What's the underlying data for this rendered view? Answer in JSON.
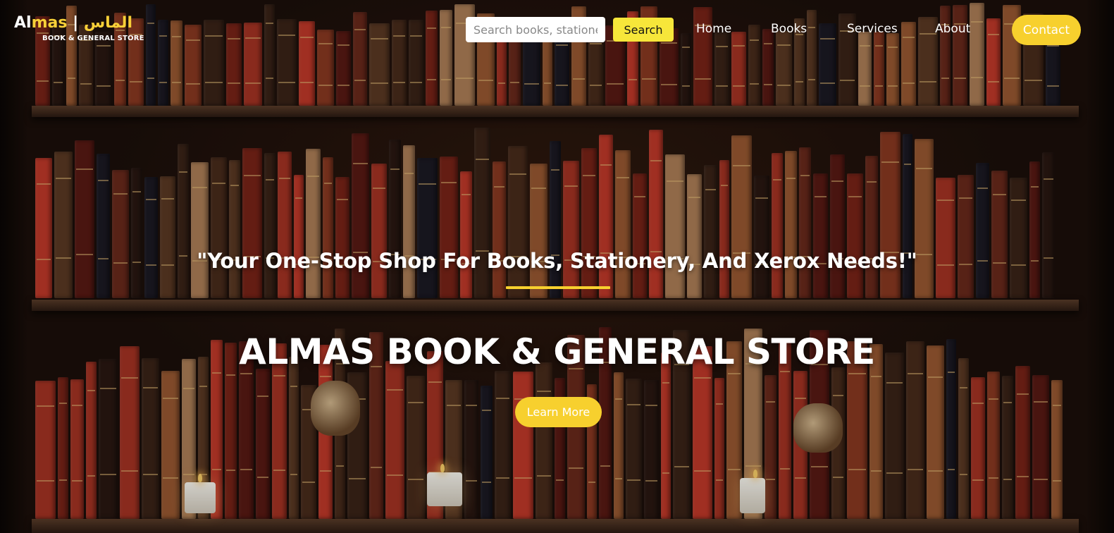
{
  "brand": {
    "logo_part1": "Al",
    "logo_part2": "mas",
    "logo_sep": " | ",
    "logo_arabic": "الماس",
    "logo_subtitle": "BOOK & GENERAL STORE"
  },
  "search": {
    "placeholder": "Search books, stationery...",
    "button_label": "Search"
  },
  "nav": {
    "items": [
      {
        "label": "Home"
      },
      {
        "label": "Books"
      },
      {
        "label": "Services"
      },
      {
        "label": "About"
      }
    ],
    "contact_label": "Contact"
  },
  "hero": {
    "tagline": "\"Your One-Stop Shop For Books, Stationery, And Xerox Needs!\"",
    "title": "ALMAS BOOK & GENERAL STORE",
    "cta_label": "Learn More"
  },
  "colors": {
    "accent": "#f7d02e",
    "search_button": "#f7e63a",
    "text": "#ffffff"
  }
}
